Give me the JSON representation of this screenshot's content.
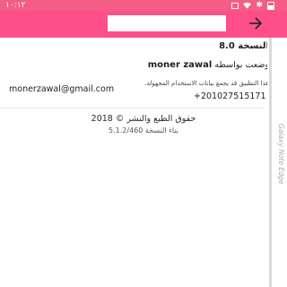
{
  "status_bar": {
    "time": "١٠:١٢",
    "icons": [
      "image-icon",
      "wifi-icon",
      "bluetooth-icon",
      "battery-icon"
    ],
    "color": "#f45d84"
  },
  "toolbar": {
    "title": "",
    "back_icon": "arrow-right-icon",
    "color": "#ff4f8a"
  },
  "about": {
    "version": "النسخة 8.0",
    "made_by_prefix": "وضعت بواسطه",
    "author": "moner zawal",
    "privacy_note": "هذا التطبيق قد يجمع بيانات الاستخدام المجهولة.",
    "email": "monerzawal@gmail.com",
    "phone": "+201027515171",
    "copyright": "حقوق الطبع والنشر © 2018",
    "build": "بناء النسخة 5.1.2/460"
  },
  "edge": {
    "label": "Galaxy Note Edge"
  }
}
